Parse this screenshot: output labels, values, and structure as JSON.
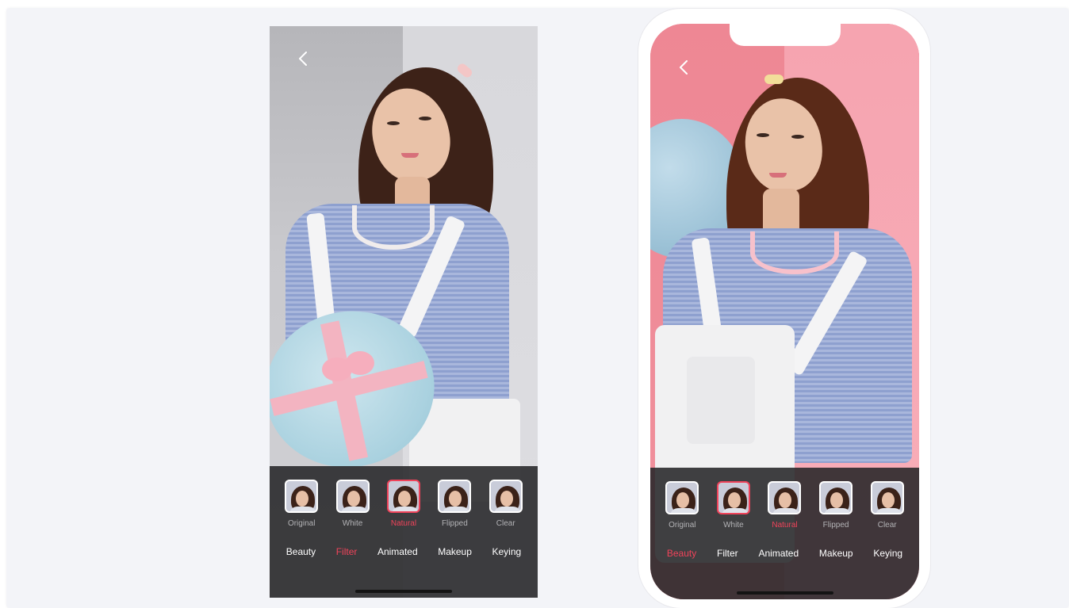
{
  "theme": {
    "accent": "#f0435a",
    "panel_bg": "#262628",
    "page_bg": "#f3f4f8"
  },
  "left_phone": {
    "back_icon": "chevron-left-icon",
    "filters": [
      {
        "label": "Original",
        "selected": false,
        "active": false
      },
      {
        "label": "White",
        "selected": false,
        "active": false
      },
      {
        "label": "Natural",
        "selected": true,
        "active": true
      },
      {
        "label": "Flipped",
        "selected": false,
        "active": false
      },
      {
        "label": "Clear",
        "selected": false,
        "active": false
      }
    ],
    "tabs": [
      {
        "label": "Beauty",
        "active": false
      },
      {
        "label": "Filter",
        "active": true
      },
      {
        "label": "Animated",
        "active": false
      },
      {
        "label": "Makeup",
        "active": false
      },
      {
        "label": "Keying",
        "active": false
      }
    ]
  },
  "right_phone": {
    "back_icon": "chevron-left-icon",
    "filters": [
      {
        "label": "Original",
        "selected": false,
        "active": false
      },
      {
        "label": "White",
        "selected": true,
        "active": false
      },
      {
        "label": "Natural",
        "selected": false,
        "active": true
      },
      {
        "label": "Flipped",
        "selected": false,
        "active": false
      },
      {
        "label": "Clear",
        "selected": false,
        "active": false
      }
    ],
    "tabs": [
      {
        "label": "Beauty",
        "active": true
      },
      {
        "label": "Filter",
        "active": false
      },
      {
        "label": "Animated",
        "active": false
      },
      {
        "label": "Makeup",
        "active": false
      },
      {
        "label": "Keying",
        "active": false
      }
    ]
  }
}
